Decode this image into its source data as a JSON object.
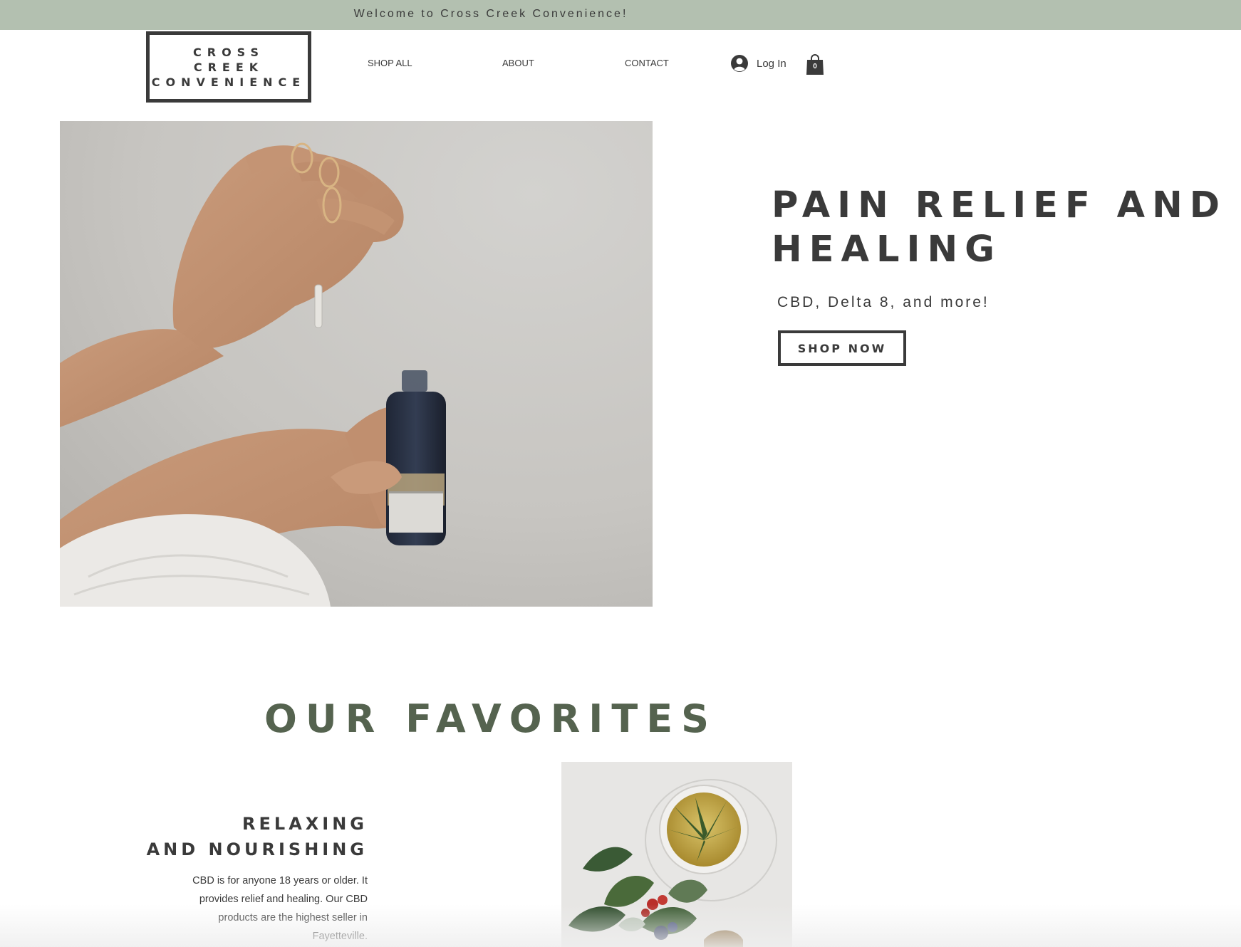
{
  "announcement": {
    "text": "Welcome to Cross Creek Convenience!"
  },
  "header": {
    "logo_lines": [
      "CROSS",
      "CREEK",
      "CONVENIENCE"
    ],
    "nav": [
      {
        "label": "SHOP ALL"
      },
      {
        "label": "ABOUT"
      },
      {
        "label": "CONTACT"
      }
    ],
    "login_label": "Log In",
    "login_icon": "user-avatar-icon",
    "cart_icon": "shopping-bag-icon",
    "cart_count": "0"
  },
  "hero": {
    "title": "PAIN RELIEF AND HEALING",
    "subtitle": "CBD, Delta 8, and more!",
    "button_label": "SHOP NOW"
  },
  "favorites": {
    "title": "OUR FAVORITES",
    "heading_lines": [
      "RELAXING",
      "AND NOURISHING"
    ],
    "body_lines": [
      "CBD is for anyone 18 years or older. It",
      "provides relief and healing. Our CBD",
      "products are the highest seller in",
      "Fayetteville."
    ]
  },
  "colors": {
    "announcement_bg": "#b3c0b0",
    "text_dark": "#3a3a3a",
    "favorites_title": "#55634f"
  }
}
